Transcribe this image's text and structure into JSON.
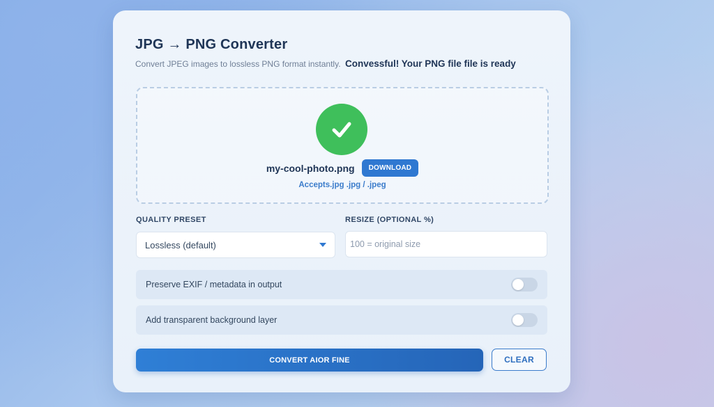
{
  "header": {
    "title": "JPG → PNG Converter",
    "subtitle": "Convert JPEG images to lossless PNG format instantly.",
    "toast": "Convessful! Your PNG file file is ready"
  },
  "dropzone": {
    "status": "success",
    "icon": "check-icon",
    "filename": "my-cool-photo.png",
    "download_label": "DOWNLOAD",
    "accepts": "Accepts.jpg .jpg / .jpeg"
  },
  "options": {
    "quality_label": "QUALITY PRESET",
    "quality_value": "Lossless (default)",
    "resize_label": "RESIZE (OPTIONAL %)",
    "resize_placeholder": "100 = original size",
    "toggles": [
      {
        "label": "Preserve EXIF / metadata in output",
        "on": false
      },
      {
        "label": "Add transparent background layer",
        "on": false
      }
    ]
  },
  "actions": {
    "convert_label": "CONVERT AIOR FINE",
    "clear_label": "CLEAR"
  },
  "colors": {
    "accent": "#2f78d1",
    "success": "#3fbf5b",
    "title": "#1f3556"
  }
}
